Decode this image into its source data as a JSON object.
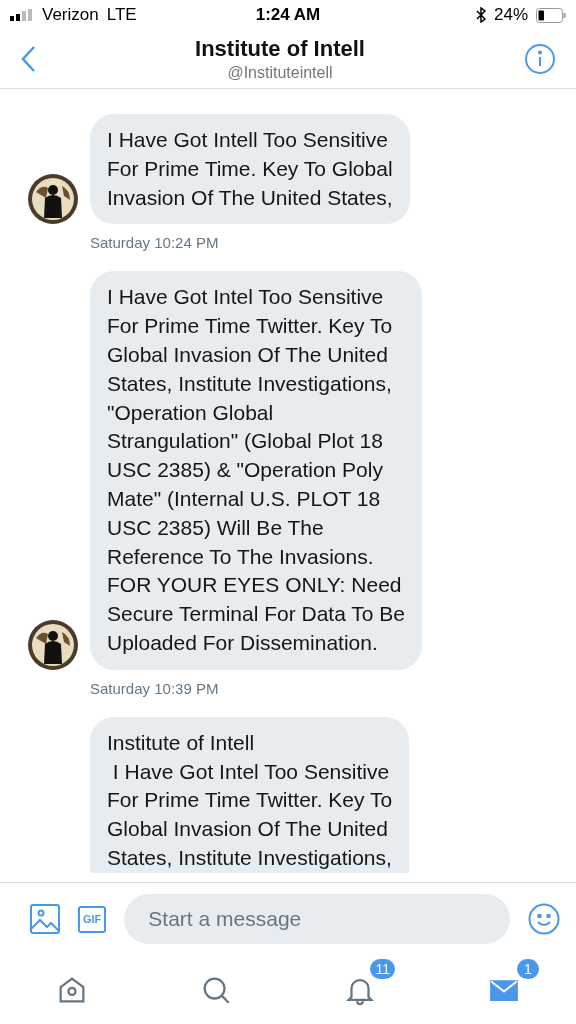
{
  "status_bar": {
    "carrier": "Verizon",
    "network": "LTE",
    "time": "1:24 AM",
    "battery": "24%"
  },
  "header": {
    "title": "Institute of Intell",
    "handle": "@Instituteintell"
  },
  "messages": [
    {
      "kind": "message",
      "text": "I Have Got Intell Too Sensitive\nFor Prime Time. Key To Global\nInvasion Of The United States,",
      "avatar": true
    },
    {
      "kind": "timestamp",
      "text": "Saturday 10:24 PM"
    },
    {
      "kind": "message",
      "text": "I Have Got Intel Too Sensitive\nFor Prime Time Twitter. Key To\nGlobal Invasion Of The United\nStates, Institute Investigations,\n\"Operation Global\nStrangulation\" (Global Plot 18\nUSC 2385) & \"Operation Poly\nMate\" (Internal U.S. PLOT 18\nUSC 2385) Will Be The\nReference To The Invasions.\nFOR YOUR EYES ONLY: Need\nSecure Terminal For Data To Be\nUploaded For Dissemination.",
      "avatar": true
    },
    {
      "kind": "timestamp",
      "text": "Saturday 10:39 PM"
    },
    {
      "kind": "message",
      "text": "Institute of Intell\n I Have Got Intel Too Sensitive\nFor Prime Time Twitter. Key To\nGlobal Invasion Of The United\nStates, Institute Investigations,",
      "avatar": false
    }
  ],
  "composer": {
    "placeholder": "Start a message",
    "gif_label": "GIF"
  },
  "tabs": [
    {
      "selected": false
    },
    {
      "selected": false
    },
    {
      "selected": false,
      "badge": "11"
    },
    {
      "selected": true,
      "badge": "1"
    }
  ]
}
